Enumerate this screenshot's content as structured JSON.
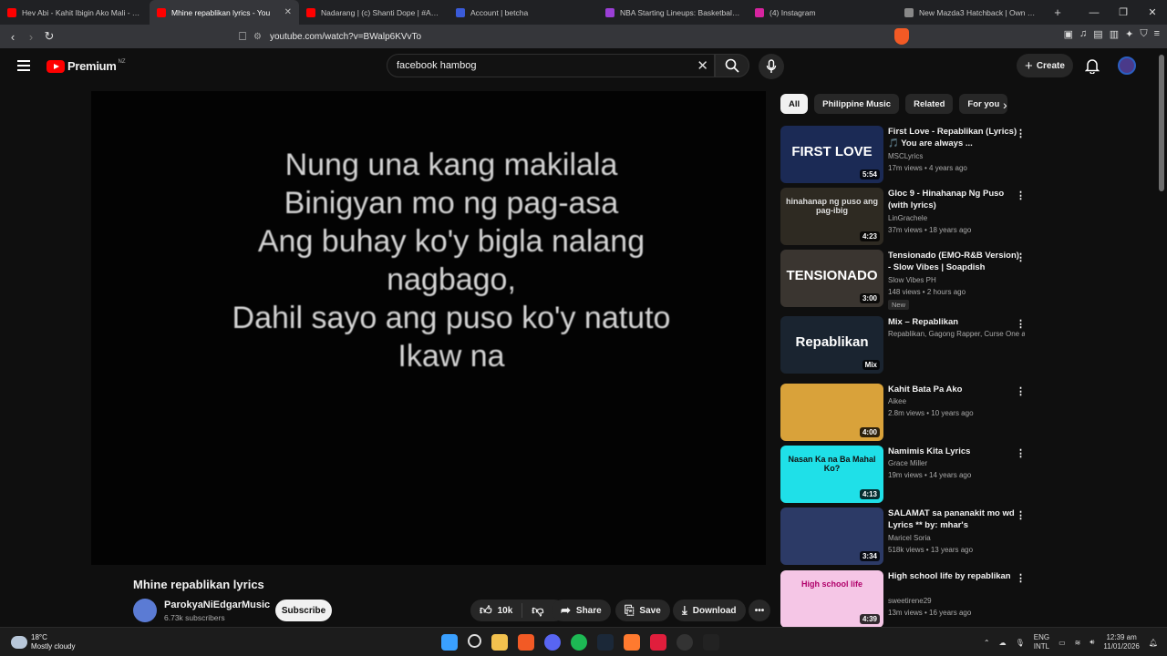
{
  "browser": {
    "tabs": [
      {
        "label": "Hev Abi - Kahit Ibigin Ako Mali - You",
        "color": "#ff0000"
      },
      {
        "label": "Mhine repablikan lyrics - You",
        "color": "#ff0000",
        "active": true
      },
      {
        "label": "Nadarang | (c) Shanti Dope | #Agsun",
        "color": "#ff0000"
      },
      {
        "label": "Account | betcha",
        "color": "#3a5bd9"
      },
      {
        "label": "NBA Starting Lineups: Basketball Dai",
        "color": "#9b3fd6"
      },
      {
        "label": "(4) Instagram",
        "color": "#d6249f"
      },
      {
        "label": "New Mazda3 Hatchback | Own The I",
        "color": "#888888"
      }
    ],
    "new_tab": "+",
    "url": "youtube.com/watch?v=BWalp6KVvTo"
  },
  "header": {
    "logo_text": "Premium",
    "country": "NZ",
    "search_value": "facebook hambog",
    "create_label": "Create"
  },
  "player": {
    "lyrics": [
      "Nung una kang makilala",
      "Binigyan mo ng pag-asa",
      "Ang buhay ko'y bigla nalang",
      "nagbago,",
      "Dahil sayo ang puso ko'y natuto",
      "Ikaw na"
    ]
  },
  "video": {
    "title": "Mhine repablikan lyrics",
    "channel": "ParokyaNiEdgarMusic",
    "subscribers": "6.73k subscribers",
    "subscribe_label": "Subscribe",
    "likes": "10k",
    "share_label": "Share",
    "save_label": "Save",
    "download_label": "Download"
  },
  "chips": [
    "All",
    "Philippine Music",
    "Related",
    "For you"
  ],
  "recommendations": [
    {
      "title": "First Love - Repablikan (Lyrics) 🎵 You are always ...",
      "channel": "MSCLyrics",
      "meta": "17m views • 4 years ago",
      "duration": "5:54",
      "thumb_text": "FIRST LOVE",
      "thumb_bg": "#1b2a55",
      "thumb_fg": "#ffffff"
    },
    {
      "title": "Gloc 9 - Hinahanap Ng Puso (with lyrics)",
      "channel": "LinGrachele",
      "meta": "37m views • 18 years ago",
      "duration": "4:23",
      "thumb_text": "hinahanap ng puso ang pag-ibig",
      "thumb_bg": "#2e2a22",
      "thumb_fg": "#dddddd"
    },
    {
      "title": "Tensionado (EMO-R&B Version) - Slow Vibes | Soapdish",
      "channel": "Slow Vibes PH",
      "meta": "148 views • 2 hours ago",
      "duration": "3:00",
      "thumb_text": "TENSIONADO",
      "thumb_bg": "#3a3530",
      "thumb_fg": "#ffffff",
      "badge": "New"
    },
    {
      "title": "Mix – Repablikan",
      "channel": "Repablikan, Gagong Rapper, Curse One a...",
      "meta": "",
      "duration": "Mix",
      "thumb_text": "Repablikan",
      "thumb_bg": "#1a2430",
      "thumb_fg": "#ffffff"
    },
    {
      "title": "Kahit Bata Pa Ako",
      "channel": "Aikee",
      "meta": "2.8m views • 10 years ago",
      "duration": "4:00",
      "thumb_text": "",
      "thumb_bg": "#d9a23a",
      "thumb_fg": "#ffffff"
    },
    {
      "title": "Namimis Kita Lyrics",
      "channel": "Grace Miller",
      "meta": "19m views • 14 years ago",
      "duration": "4:13",
      "thumb_text": "Nasan Ka na Ba Mahal Ko?",
      "thumb_bg": "#1fe0e8",
      "thumb_fg": "#111111"
    },
    {
      "title": "SALAMAT sa pananakit mo wd Lyrics ** by: mhar's",
      "channel": "Maricel Soria",
      "meta": "518k views • 13 years ago",
      "duration": "3:34",
      "thumb_text": "",
      "thumb_bg": "#2c3a66",
      "thumb_fg": "#ffffff"
    },
    {
      "title": "High school life by repablikan",
      "channel": "sweetirene29",
      "meta": "13m views • 16 years ago",
      "duration": "4:39",
      "thumb_text": "High school life",
      "thumb_bg": "#f5c6e6",
      "thumb_fg": "#b0006a"
    }
  ],
  "taskbar": {
    "temp": "18°C",
    "weather": "Mostly cloudy",
    "lang1": "ENG",
    "lang2": "INTL",
    "time": "12:39 am",
    "date": "11/01/2026"
  }
}
